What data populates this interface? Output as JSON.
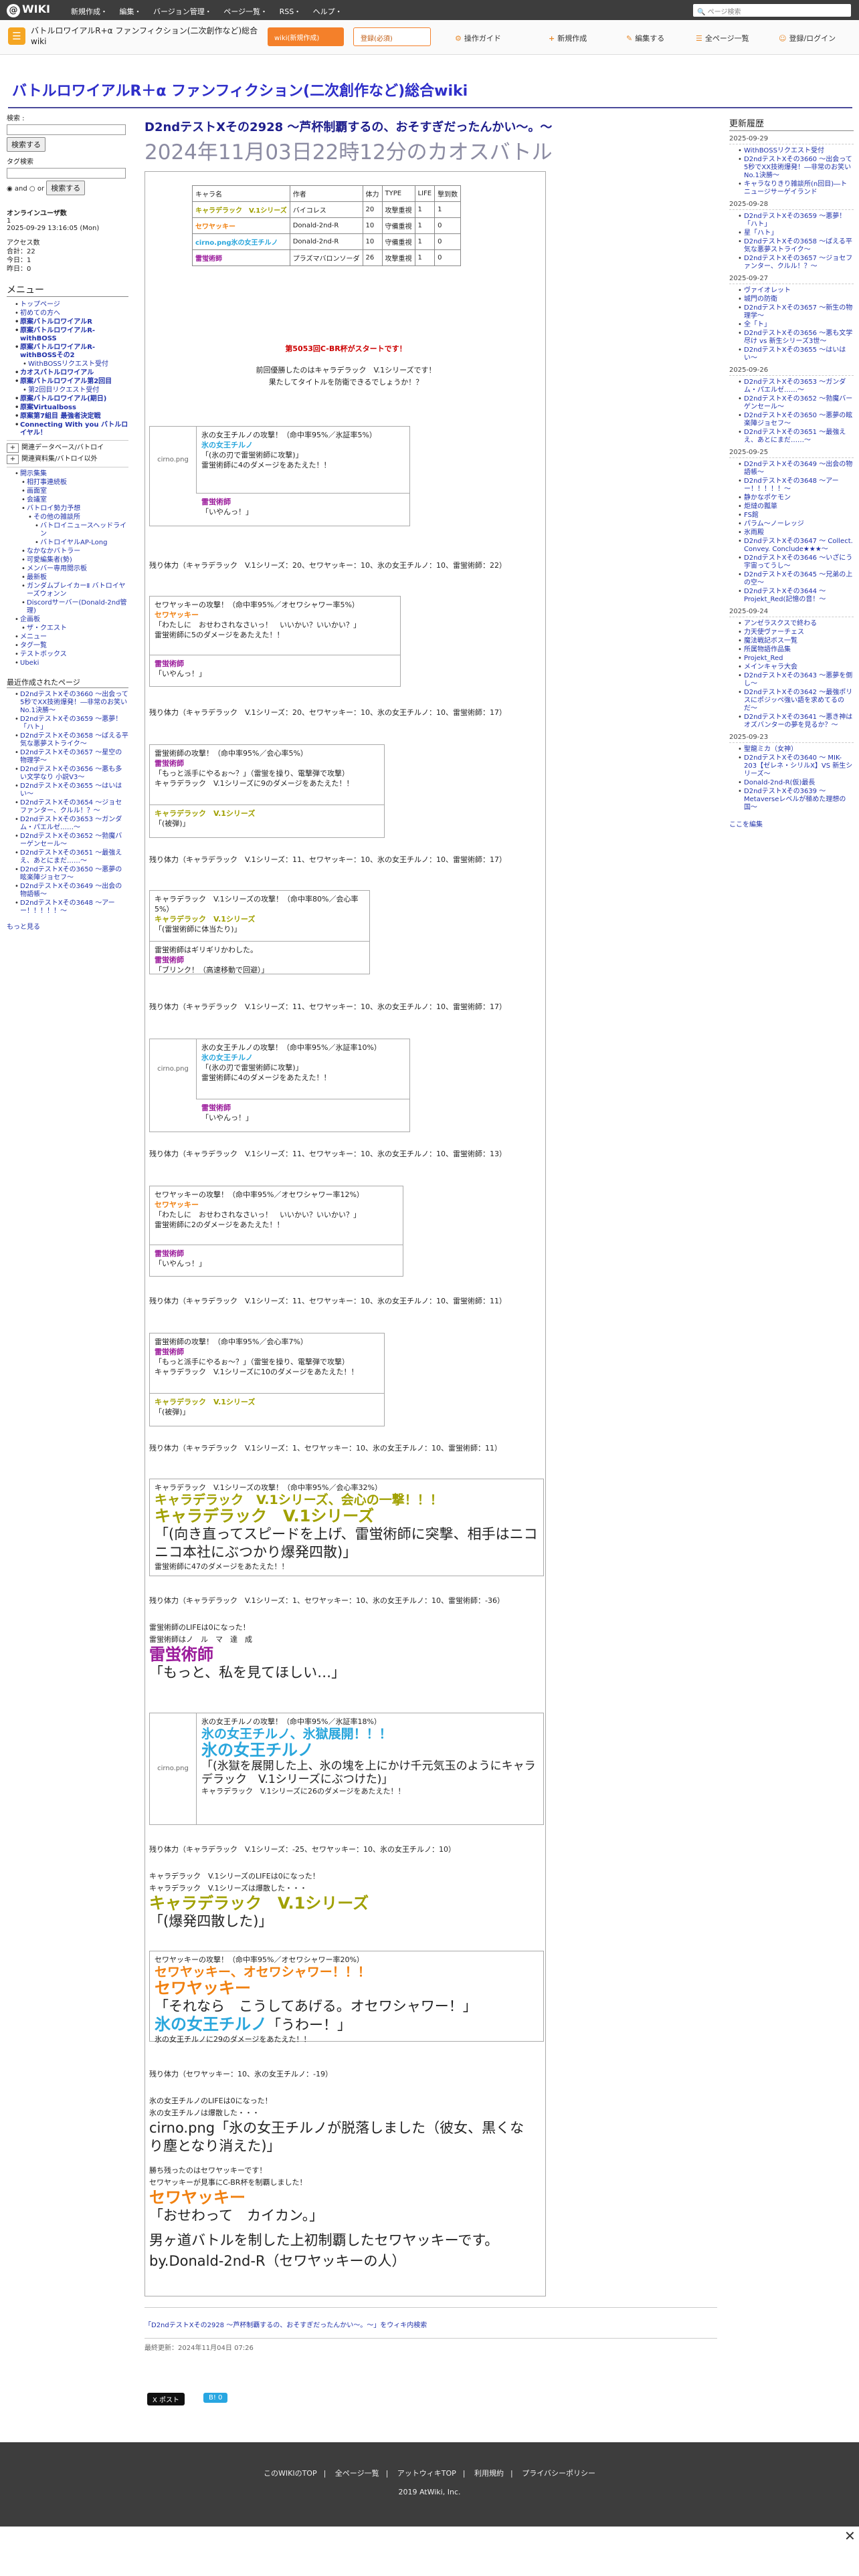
{
  "topbar": {
    "logo": "WIKI",
    "menu": [
      "新規作成・",
      "編集・",
      "バージョン管理・",
      "ページ一覧・",
      "RSS・",
      "ヘルプ・"
    ],
    "search_placeholder": "ページ検索"
  },
  "site": {
    "name": "バトルロワイアルR+α ファンフィクション(二次創作など)総合wiki",
    "btn_wiki": "wiki(新規作成)",
    "btn_reg": "登録(必須)",
    "tools": [
      "操作ガイド",
      "新規作成",
      "編集する",
      "全ページ一覧",
      "登録/ログイン"
    ]
  },
  "wiki_title": "バトルロワイアルR＋α ファンフィクション(二次創作など)総合wiki",
  "left": {
    "search_label": "検索 :",
    "search_btn": "検索する",
    "tag_label": "タグ検索",
    "and": "and",
    "or": "or",
    "tag_btn": "検索する",
    "online": "オンラインユーザ数",
    "online_n": "1",
    "date": "2025-09-29 13:16:05 (Mon)",
    "access": [
      "アクセス数",
      "合計：22",
      "今日：1",
      "昨日：0"
    ],
    "menu_title": "メニュー",
    "menu": [
      "トップページ",
      "初めての方へ",
      "原案バトルロワイアルR",
      "原案バトルロワイアルR-withBOSS",
      "原案バトルロワイアルR-withBOSSその2",
      "WithBOSSリクエスト受付",
      "カオスバトルロワイアル",
      "原案バトルロワイアル第2回目",
      "第2回目リクエスト受付",
      "原案バトルロワイアル(期日)",
      "原案Virtualboss",
      "原案第7組目 最強者決定戦",
      "Connecting With you バトルロイヤル！"
    ],
    "sub1": [
      "関連データベース/バトロイ",
      "関連資料集/バトロイ以外"
    ],
    "list2": [
      "開示集集",
      "相打事連続板",
      "画面室",
      "会議室",
      "バトロイ勢力予想",
      "その他の雑談所",
      "バトロイニュースヘッドライン",
      "バトロイヤルAP-Long",
      "なかなかバトラー",
      "可愛編集者(勢)",
      "メンバー専用閲示板",
      "最新板",
      "ガンダムブレイカーⅡ バトロイヤーズウォンン",
      "Discordサーバー(Donald-2nd管理)",
      "企画板",
      "ザ・クエスト"
    ],
    "misc": [
      "メニュー",
      "タグ一覧",
      "テストボックス",
      "Ubeki"
    ],
    "recent_title": "最近作成されたページ",
    "recent": [
      "D2ndテストXその3660 〜出会って5秒でXX技術爆発！―非常のお笑いNo.1決勝〜",
      "D2ndテストXその3659 〜悪夢！「ハト」",
      "D2ndテストXその3658 〜ばえる平気な悪夢ストライク〜",
      "D2ndテストXその3657 〜星空の物理学〜",
      "D2ndテストXその3656 〜悪も多い文学なり 小説V3〜",
      "D2ndテストXその3655 〜はいはい〜",
      "D2ndテストXその3654 〜ジョセファンター、クルル！？〜",
      "D2ndテストXその3653 〜ガンダム・パエルゼ……〜",
      "D2ndテストXその3652 〜勃魔バーゲンセール〜",
      "D2ndテストXその3651 〜最強ええ、あとにまだ……〜",
      "D2ndテストXその3650 〜悪夢の眩楽陣ジョセフ〜",
      "D2ndテストXその3649 〜出会の物語帳〜",
      "D2ndテストXその3648 〜アーー！！！！！〜"
    ],
    "more": "もっと見る"
  },
  "title": "D2ndテストXその2928 〜芦杯制覇するの、おそすぎだったんかい〜。〜",
  "subtitle": "2024年11月03日22時12分のカオスバトル",
  "members": {
    "headers": [
      "キャラ名",
      "作者",
      "体力",
      "TYPE",
      "LIFE",
      "撃到数"
    ],
    "rows": [
      [
        "キャラデラック　V.1シリーズ",
        "バイコレス",
        "20",
        "攻撃重視",
        "1",
        "1"
      ],
      [
        "セワヤッキー",
        "Donald-2nd-R",
        "10",
        "守備重視",
        "1",
        "0"
      ],
      [
        "cirno.png氷の女王チルノ",
        "Donald-2nd-R",
        "10",
        "守備重視",
        "1",
        "0"
      ],
      [
        "雷蛍術師",
        "プラズマバロンソーダ",
        "26",
        "攻撃重視",
        "1",
        "0"
      ]
    ]
  },
  "intro": [
    "第5053回C-BR杯がスタートです！",
    "前回優勝したのはキャラデラック　V.1シリーズです！",
    "果たしてタイトルを防衛できるでしょうか！？"
  ],
  "hp_label": "残り体力",
  "battle1": {
    "img": "cirno.png",
    "att": "氷の女王チルノの攻撃！（命中率95%／氷証率5%）",
    "a": "氷の女王チルノ",
    "q": "「(氷の刃で雷蛍術師に攻撃)」",
    "dmg": "雷蛍術師に4のダメージをあたえた！！",
    "d": "雷蛍術師",
    "dq": "「いやんっ！」"
  },
  "hp1": "（キャラデラック　V.1シリーズ：20、セワヤッキー：10、氷の女王チルノ：10、雷蛍術師：22）",
  "battle2": {
    "att": "セワヤッキーの攻撃！（命中率95%／オセワシャワー率5%）",
    "a": "セワヤッキー",
    "q": "「わたしに　おせわされなさいっ！　いいかい？いいかい？」",
    "dmg": "雷蛍術師に5のダメージをあたえた！！",
    "d": "雷蛍術師",
    "dq": "「いやんっ！」"
  },
  "hp2": "（キャラデラック　V.1シリーズ：20、セワヤッキー：10、氷の女王チルノ：10、雷蛍術師：17）",
  "battle3": {
    "att": "雷蛍術師の攻撃！（命中率95%／会心率5%）",
    "a": "雷蛍術師",
    "q": "「もっと派手にやるぉ〜？」（雷蛍を操り、電撃弾で攻撃）",
    "dmg": "キャラデラック　V.1シリーズに9のダメージをあたえた！！",
    "d": "キャラデラック　V.1シリーズ",
    "dq": "「(被弾)」"
  },
  "hp3": "（キャラデラック　V.1シリーズ：11、セワヤッキー：10、氷の女王チルノ：10、雷蛍術師：17）",
  "battle4": {
    "att": "キャラデラック　V.1シリーズの攻撃！（命中率80%／会心率5%）",
    "a": "キャラデラック　V.1シリーズ",
    "q": "「(雷蛍術師に体当たり)」",
    "mis": "雷蛍術師はギリギリかわした。",
    "d": "雷蛍術師",
    "dq": "「ブリンク！（高速移動で回避）」"
  },
  "hp4": "（キャラデラック　V.1シリーズ：11、セワヤッキー：10、氷の女王チルノ：10、雷蛍術師：17）",
  "battle5": {
    "img": "cirno.png",
    "att": "氷の女王チルノの攻撃！（命中率95%／氷証率10%）",
    "a": "氷の女王チルノ",
    "q": "「(氷の刃で雷蛍術師に攻撃)」",
    "dmg": "雷蛍術師に4のダメージをあたえた！！",
    "d": "雷蛍術師",
    "dq": "「いやんっ！」"
  },
  "hp5": "（キャラデラック　V.1シリーズ：11、セワヤッキー：10、氷の女王チルノ：10、雷蛍術師：13）",
  "battle6": {
    "att": "セワヤッキーの攻撃！（命中率95%／オセワシャワー率12%）",
    "a": "セワヤッキー",
    "q": "「わたしに　おせわされなさいっ！　いいかい？いいかい？」",
    "dmg": "雷蛍術師に2のダメージをあたえた！！",
    "d": "雷蛍術師",
    "dq": "「いやんっ！」"
  },
  "hp6": "（キャラデラック　V.1シリーズ：11、セワヤッキー：10、氷の女王チルノ：10、雷蛍術師：11）",
  "battle7": {
    "att": "雷蛍術師の攻撃！（命中率95%／会心率7%）",
    "a": "雷蛍術師",
    "q": "「もっと派手にやるぉ〜？」（雷蛍を操り、電撃弾で攻撃）",
    "dmg": "キャラデラック　V.1シリーズに10のダメージをあたえた！！",
    "d": "キャラデラック　V.1シリーズ",
    "dq": "「(被弾)」"
  },
  "hp7": "（キャラデラック　V.1シリーズ：1、セワヤッキー：10、氷の女王チルノ：10、雷蛍術師：11）",
  "battle8": {
    "att": "キャラデラック　V.1シリーズの攻撃！（命中率95%／会心率32%）",
    "crit1": "キャラデラック　V.1シリーズ、会心の一撃！！！",
    "a": "キャラデラック　V.1シリーズ",
    "q": "「(向き直ってスピードを上げ、雷蛍術師に突撃、相手はニコニコ本社にぶつかり爆発四散)」",
    "dmg": "雷蛍術師に47のダメージをあたえた！！"
  },
  "hp8": "（キャラデラック　V.1シリーズ：1、セワヤッキー：10、氷の女王チルノ：10、雷蛍術師：-36）",
  "death1": [
    "雷蛍術師のLIFEは0になった！",
    "雷蛍術師はノ　ル　マ　達　成"
  ],
  "death1name": "雷蛍術師",
  "death1q": "「もっと、私を見てほしい…」",
  "battle9": {
    "img": "cirno.png",
    "att": "氷の女王チルノの攻撃！（命中率95%／氷証率18%）",
    "crit1": "氷の女王チルノ、氷獄展開！！！",
    "a": "氷の女王チルノ",
    "q": "「(氷獄を展開した上、氷の塊を上にかけ千元気玉のようにキャラデラック　V.1シリーズにぶつけた)」",
    "dmg": "キャラデラック　V.1シリーズに26のダメージをあたえた！！"
  },
  "hp9": "（キャラデラック　V.1シリーズ：-25、セワヤッキー：10、氷の女王チルノ：10）",
  "death2": [
    "キャラデラック　V.1シリーズのLIFEは0になった！",
    "キャラデラック　V.1シリーズは爆散した・・・"
  ],
  "death2name": "キャラデラック　V.1シリーズ",
  "death2q": "「(爆発四散した)」",
  "battle10": {
    "att": "セワヤッキーの攻撃！（命中率95%／オセワシャワー率20%）",
    "crit1": "セワヤッキー、オセワシャワー！！！",
    "a": "セワヤッキー",
    "q": "「それなら　こうしてあげる。オセワシャワー！」",
    "d": "氷の女王チルノ",
    "dq": "「うわー！」",
    "dmg": "氷の女王チルノに29のダメージをあたえた！！"
  },
  "hp10": "（セワヤッキー：10、氷の女王チルノ：-19）",
  "death3": [
    "氷の女王チルノのLIFEは0になった！",
    "氷の女王チルノは爆散した・・・"
  ],
  "death3big": "cirno.png「氷の女王チルノが脱落しました（彼女、黒くなり塵となり消えた)」",
  "win1": "勝ち残ったのはセワヤッキーです！",
  "win2": "セワヤッキーが見事にC-BR杯を制覇しました！",
  "winname": "セワヤッキー",
  "winq": "「おせわって　カイカン。」",
  "closing": "男ヶ道バトルを制した上初制覇したセワヤッキーです。",
  "by": "by.Donald-2nd-R（セワヤッキーの人）",
  "editlink": "「D2ndテストXその2928 〜芦杯制覇するの、おそすぎだったんかい〜。〜」をウィキ内検索",
  "lastupdate": "最終更新：2024年11月04日 07:26",
  "share": [
    "X ポスト",
    "B! 0"
  ],
  "right": {
    "title": "更新履歴",
    "groups": [
      {
        "date": "2025-09-29",
        "items": [
          "WithBOSSリクエスト受付",
          "D2ndテストXその3660 〜出会って5秒でXX技術爆発！―非常のお笑いNo.1決勝〜",
          "キャラなりきり雑談所(n回目)―トニュージサーゲイランド"
        ]
      },
      {
        "date": "2025-09-28",
        "items": [
          "D2ndテストXその3659 〜悪夢！「ハト」",
          "星「ハト」",
          "D2ndテストXその3658 〜ばえる平気な悪夢ストライク〜",
          "D2ndテストXその3657 〜ジョセファンター、クルル！？〜"
        ]
      },
      {
        "date": "2025-09-27",
        "items": [
          "ヴァイオレット",
          "城門の防衛",
          "D2ndテストXその3657 〜新生の物理学〜",
          "全「ト」",
          "D2ndテストXその3656 〜悪も文学尽け vs 新生シリーズ3世〜",
          "D2ndテストXその3655 〜はいはい〜"
        ]
      },
      {
        "date": "2025-09-26",
        "items": [
          "D2ndテストXその3653 〜ガンダム・パエルゼ……〜",
          "D2ndテストXその3652 〜勃魔バーゲンセール〜",
          "D2ndテストXその3650 〜悪夢の眩楽陣ジョセフ〜",
          "D2ndテストXその3651 〜最強ええ、あとにまだ……〜"
        ]
      },
      {
        "date": "2025-09-25",
        "items": [
          "D2ndテストXその3649 〜出会の物語帳〜",
          "D2ndテストXその3648 〜アーー！！！！！〜",
          "静かなポケモン",
          "炬燵の瓢箪",
          "FS館",
          "パラム～ノーレッジ",
          "氷雨殿",
          "D2ndテストXその3647 〜 Collect. Convey. Conclude★★★〜",
          "D2ndテストXその3646 〜いざにう宇宙ってうし〜",
          "D2ndテストXその3645 〜兄弟の上の空〜",
          "D2ndテストXその3644 〜 Projekt_Red(記憶の音！〜"
        ]
      },
      {
        "date": "2025-09-24",
        "items": [
          "アンゼラスクスで終わる",
          "力天使ヴァーチェス",
          "魔法戦記ボス一覧",
          "所属物語作品集",
          "Projekt_Red",
          "メインキャラ大会",
          "D2ndテストXその3643 〜悪夢を倒し〜",
          "D2ndテストXその3642 〜最強ポリスにポジッペ強い語を求めてるのだ〜",
          "D2ndテストXその3641 〜悪き神はオズバンターの夢を見るか？〜"
        ]
      },
      {
        "date": "2025-09-23",
        "items": [
          "聖龍ミカ（女神）",
          "D2ndテストXその3640 〜 MIK-203【ゼレネ・シリルX】VS 新生シリーズ〜",
          "Donald-2nd-R(仮)最長",
          "D2ndテストXその3639 〜 Metaverseレベルが極めた理想の国〜"
        ]
      }
    ],
    "edit": "ここを編集"
  },
  "footer": {
    "links": [
      "このWIKIのTOP",
      "全ページ一覧",
      "アットウィキTOP",
      "利用規約",
      "プライバシーポリシー"
    ],
    "copy": "2019 AtWiki, Inc."
  }
}
